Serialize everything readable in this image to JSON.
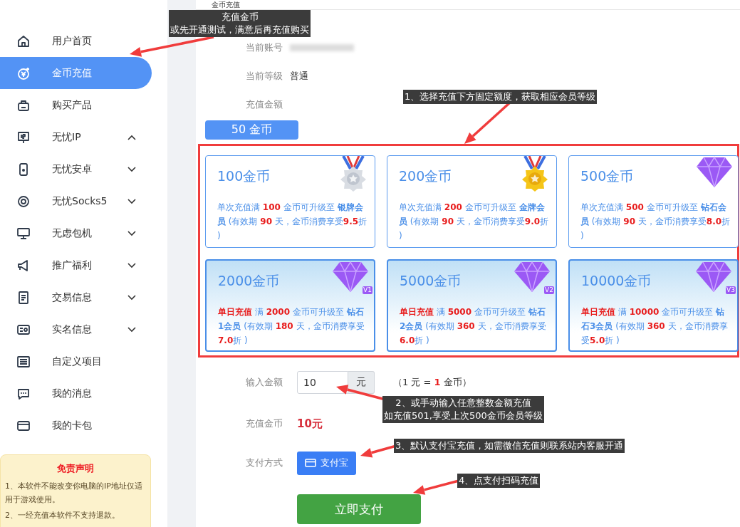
{
  "page_title": "金币充值",
  "sidebar": {
    "items": [
      {
        "label": "用户首页",
        "selected": false
      },
      {
        "label": "金币充值",
        "selected": true
      },
      {
        "label": "购买产品",
        "selected": false
      },
      {
        "label": "无忧IP",
        "selected": false,
        "expanded": true
      },
      {
        "label": "无忧安卓",
        "selected": false,
        "expanded": false
      },
      {
        "label": "无忧Socks5",
        "selected": false,
        "expanded": false
      },
      {
        "label": "无虑包机",
        "selected": false,
        "expanded": false
      },
      {
        "label": "推广福利",
        "selected": false,
        "expanded": false
      },
      {
        "label": "交易信息",
        "selected": false,
        "expanded": false
      },
      {
        "label": "实名信息",
        "selected": false,
        "expanded": false
      },
      {
        "label": "自定义项目",
        "selected": false
      },
      {
        "label": "我的消息",
        "selected": false
      },
      {
        "label": "我的卡包",
        "selected": false
      }
    ],
    "disclaimer": {
      "title": "免责声明",
      "lines": [
        "1、本软件不能改变你电脑的IP地址仅适用于游戏使用。",
        "2、一经充值本软件不支持退款。"
      ]
    }
  },
  "account": {
    "label": "当前账号"
  },
  "level": {
    "label": "当前等级",
    "value": "普通"
  },
  "amount": {
    "label": "充值金额",
    "preset": "50 金币",
    "preset_selected": true
  },
  "cards": [
    {
      "kind": "silver",
      "title": "100金币",
      "desc": [
        {
          "t": "单次充值满 ",
          "kind": "plain"
        },
        {
          "t": "100",
          "kind": "number"
        },
        {
          "t": " 金币可升级至 ",
          "kind": "plain"
        },
        {
          "t": "银牌会员",
          "kind": "level"
        },
        {
          "t": " (有效期 ",
          "kind": "plain"
        },
        {
          "t": "90",
          "kind": "number"
        },
        {
          "t": " 天，金币消费享受",
          "kind": "plain"
        },
        {
          "t": "9.5",
          "kind": "number"
        },
        {
          "t": "折 )",
          "kind": "plain"
        }
      ]
    },
    {
      "kind": "gold",
      "title": "200金币",
      "desc": [
        {
          "t": "单次充值满 ",
          "kind": "plain"
        },
        {
          "t": "200",
          "kind": "number"
        },
        {
          "t": " 金币可升级至 ",
          "kind": "plain"
        },
        {
          "t": "金牌会员",
          "kind": "level"
        },
        {
          "t": " (有效期 ",
          "kind": "plain"
        },
        {
          "t": "90",
          "kind": "number"
        },
        {
          "t": " 天，金币消费享受",
          "kind": "plain"
        },
        {
          "t": "9.0",
          "kind": "number"
        },
        {
          "t": "折 )",
          "kind": "plain"
        }
      ]
    },
    {
      "kind": "diamond",
      "title": "500金币",
      "desc": [
        {
          "t": "单次充值满 ",
          "kind": "plain"
        },
        {
          "t": "500",
          "kind": "number"
        },
        {
          "t": " 金币可升级至 ",
          "kind": "plain"
        },
        {
          "t": "钻石会员",
          "kind": "level"
        },
        {
          "t": " (有效期 ",
          "kind": "plain"
        },
        {
          "t": "90",
          "kind": "number"
        },
        {
          "t": " 天，金币消费享受",
          "kind": "plain"
        },
        {
          "t": "8.0",
          "kind": "number"
        },
        {
          "t": "折 )",
          "kind": "plain"
        }
      ]
    },
    {
      "kind": "daily",
      "vip_tag": "V1",
      "title": "2000金币",
      "desc": [
        {
          "t": "单日充值",
          "kind": "number"
        },
        {
          "t": " 满 ",
          "kind": "plain"
        },
        {
          "t": "2000",
          "kind": "number"
        },
        {
          "t": " 金币可升级至 ",
          "kind": "plain"
        },
        {
          "t": "钻石1会员",
          "kind": "level"
        },
        {
          "t": " (有效期 ",
          "kind": "plain"
        },
        {
          "t": "180",
          "kind": "number"
        },
        {
          "t": " 天，金币消费享受",
          "kind": "plain"
        },
        {
          "t": "7.0",
          "kind": "number"
        },
        {
          "t": "折 )",
          "kind": "plain"
        }
      ]
    },
    {
      "kind": "daily",
      "vip_tag": "V2",
      "title": "5000金币",
      "desc": [
        {
          "t": "单日充值",
          "kind": "number"
        },
        {
          "t": " 满 ",
          "kind": "plain"
        },
        {
          "t": "5000",
          "kind": "number"
        },
        {
          "t": " 金币可升级至 ",
          "kind": "plain"
        },
        {
          "t": "钻石2会员",
          "kind": "level"
        },
        {
          "t": " (有效期 ",
          "kind": "plain"
        },
        {
          "t": "360",
          "kind": "number"
        },
        {
          "t": " 天，金币消费享受",
          "kind": "plain"
        },
        {
          "t": "6.0",
          "kind": "number"
        },
        {
          "t": "折 )",
          "kind": "plain"
        }
      ]
    },
    {
      "kind": "daily",
      "vip_tag": "V3",
      "title": "10000金币",
      "desc": [
        {
          "t": "单日充值",
          "kind": "number"
        },
        {
          "t": " 满 ",
          "kind": "plain"
        },
        {
          "t": "10000",
          "kind": "number"
        },
        {
          "t": " 金币可升级至 ",
          "kind": "plain"
        },
        {
          "t": "钻石3会员",
          "kind": "level"
        },
        {
          "t": " (有效期 ",
          "kind": "plain"
        },
        {
          "t": "360",
          "kind": "number"
        },
        {
          "t": " 天，金币消费享受",
          "kind": "plain"
        },
        {
          "t": "5.0",
          "kind": "number"
        },
        {
          "t": "折 )",
          "kind": "plain"
        }
      ]
    }
  ],
  "input": {
    "label": "输入金额",
    "value": "10",
    "unit": "元",
    "rate": [
      {
        "t": "（1 元 = ",
        "kind": "plain"
      },
      {
        "t": "1",
        "kind": "number"
      },
      {
        "t": " 金币）",
        "kind": "plain"
      }
    ]
  },
  "coins": {
    "label": "充值金币",
    "value": "10元"
  },
  "payment": {
    "label": "支付方式",
    "method": "支付宝"
  },
  "pay_button": "立即支付",
  "annotations": [
    {
      "lines": [
        "充值金币",
        "或先开通测试，满意后再充值购买"
      ]
    },
    {
      "lines": [
        "1、选择充值下方固定额度，获取相应会员等级"
      ]
    },
    {
      "lines": [
        "2、或手动输入任意整数金额充值",
        "如充值501,享受上次500金币会员等级"
      ]
    },
    {
      "lines": [
        "3、默认支付宝充值，如需微信充值则联系站内客服开通"
      ]
    },
    {
      "lines": [
        "4、点支付扫码充值"
      ]
    }
  ]
}
